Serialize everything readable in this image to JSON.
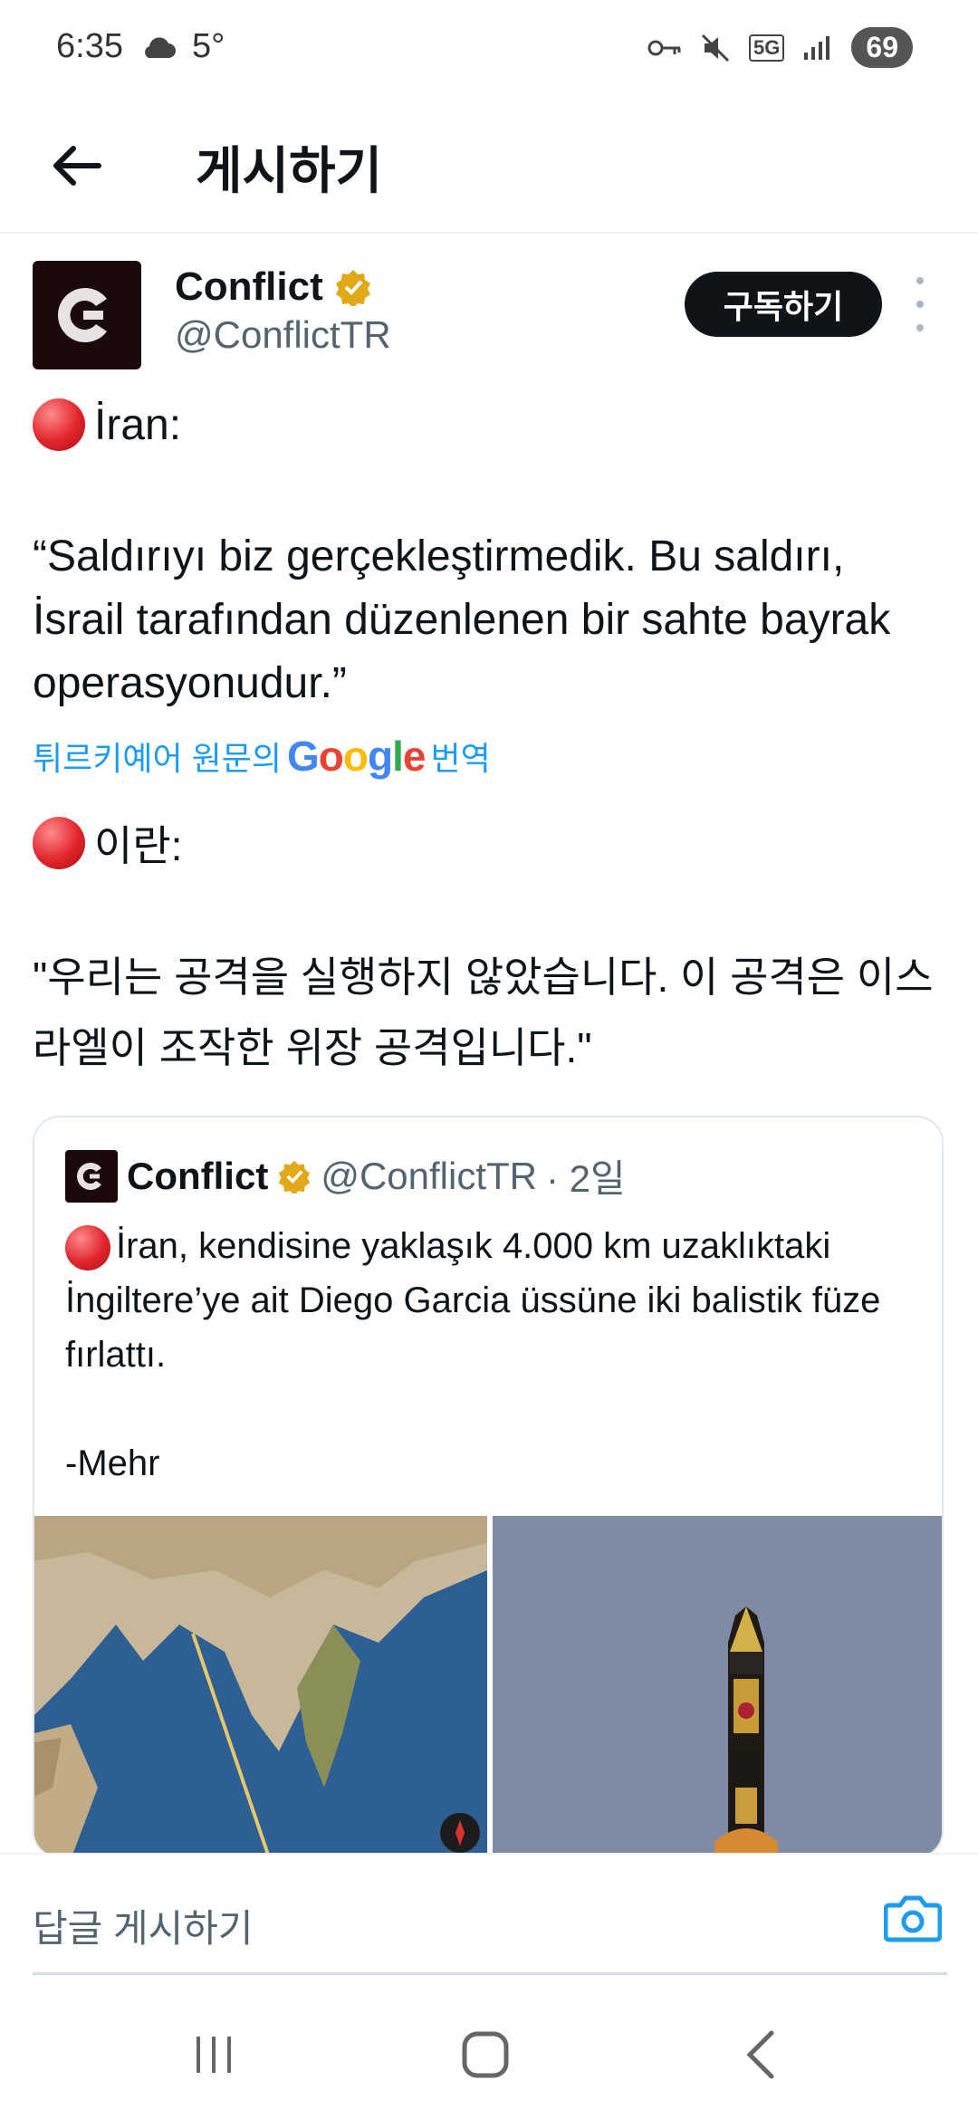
{
  "status_bar": {
    "time": "6:35",
    "temperature": "5°",
    "network": "5G",
    "battery": "69"
  },
  "header": {
    "title": "게시하기"
  },
  "author": {
    "name": "Conflict",
    "handle": "@ConflictTR",
    "subscribe_label": "구독하기"
  },
  "post": {
    "line_tr_label": "İran:",
    "quote_tr": "“Saldırıyı biz gerçekleştirmedik. Bu saldırı, İsrail tarafından düzenlenen bir sahte bayrak operasyonudur.”",
    "translate_prefix": "튀르키예어 원문의",
    "translate_brand": "Google",
    "translate_suffix": "번역",
    "line_kr_label": "이란:",
    "quote_kr": "\"우리는 공격을 실행하지 않았습니다. 이 공격은 이스라엘이 조작한 위장 공격입니다.\""
  },
  "quoted": {
    "name": "Conflict",
    "handle": "@ConflictTR",
    "time": "· 2일",
    "text": "İran, kendisine yaklaşık 4.000 km uzaklıktaki İngiltere’ye ait Diego Garcia üssüne iki balistik füze fırlattı.",
    "source": "-Mehr"
  },
  "reply": {
    "placeholder": "답글 게시하기"
  },
  "icons": {
    "back": "arrow-left-icon",
    "verified": "verified-badge-icon",
    "more": "more-vertical-icon",
    "camera": "camera-icon",
    "recents": "recents-icon",
    "home": "home-icon",
    "nav_back": "nav-back-icon"
  },
  "colors": {
    "accent": "#1d9bf0",
    "verified": "#e3a817",
    "text": "#0f1419",
    "secondary": "#536471"
  }
}
